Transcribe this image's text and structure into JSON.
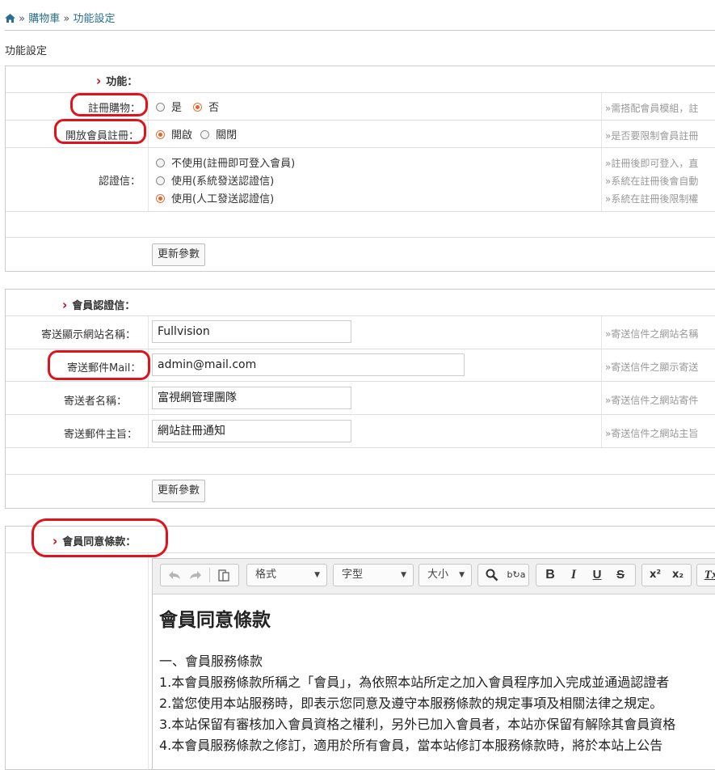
{
  "breadcrumb": {
    "home_icon": "home-icon",
    "sep": "»",
    "items": [
      "購物車",
      "功能設定"
    ]
  },
  "page": {
    "subtitle": "功能設定"
  },
  "section1": {
    "title": "功能：",
    "rows": {
      "register_shopping": {
        "label": "註冊購物：",
        "options": [
          "是",
          "否"
        ],
        "selected": "否",
        "hint": "»需搭配會員模組，註"
      },
      "open_register": {
        "label": "開放會員註冊：",
        "options": [
          "開啟",
          "關閉"
        ],
        "selected": "開啟",
        "hint": "»是否要限制會員註冊"
      },
      "verify_mail": {
        "label": "認證信：",
        "options": [
          "不使用(註冊即可登入會員)",
          "使用(系統發送認證信)",
          "使用(人工發送認證信)"
        ],
        "selected": "使用(人工發送認證信)",
        "hints": [
          "»註冊後即可登入，直",
          "»系統在註冊後會自動",
          "»系統在註冊後限制權"
        ]
      }
    },
    "update_button": "更新參數"
  },
  "section2": {
    "title": "會員認證信：",
    "rows": {
      "site_name": {
        "label": "寄送顯示網站名稱：",
        "value": "Fullvision",
        "hint": "»寄送信件之網站名稱"
      },
      "sender_mail": {
        "label": "寄送郵件Mail：",
        "value": "admin@mail.com",
        "hint": "»寄送信件之顯示寄送"
      },
      "sender_name": {
        "label": "寄送者名稱：",
        "value": "富視網管理團隊",
        "hint": "»寄送信件之網站寄件"
      },
      "subject": {
        "label": "寄送郵件主旨：",
        "value": "網站註冊通知",
        "hint": "»寄送信件之網站主旨"
      }
    },
    "update_button": "更新參數"
  },
  "section3": {
    "title": "會員同意條款：",
    "editor": {
      "toolbar": {
        "undo": "undo-icon",
        "redo": "redo-icon",
        "paste": "paste-icon",
        "format": "格式",
        "font": "字型",
        "size": "大小",
        "find": "find-icon",
        "replace": "replace-icon",
        "bold": "B",
        "italic": "I",
        "underline": "U",
        "strike": "S",
        "superscript": "x²",
        "subscript": "x₂",
        "clear": "Tx"
      },
      "content": {
        "heading": "會員同意條款",
        "section_title": "一、會員服務條款",
        "lines": [
          "1.本會員服務條款所稱之「會員」，為依照本站所定之加入會員程序加入完成並通過認證者",
          "2.當您使用本站服務時，即表示您同意及遵守本服務條款的規定事項及相關法律之規定。",
          "3.本站保留有審核加入會員資格之權利，另外已加入會員者，本站亦保留有解除其會員資格",
          "4.本會員服務條款之修訂，適用於所有會員，當本站修訂本服務條款時，將於本站上公告"
        ]
      }
    }
  },
  "colors": {
    "accent_red": "#e0131b",
    "link": "#2a6f8d",
    "radio_on": "#e8602a"
  }
}
